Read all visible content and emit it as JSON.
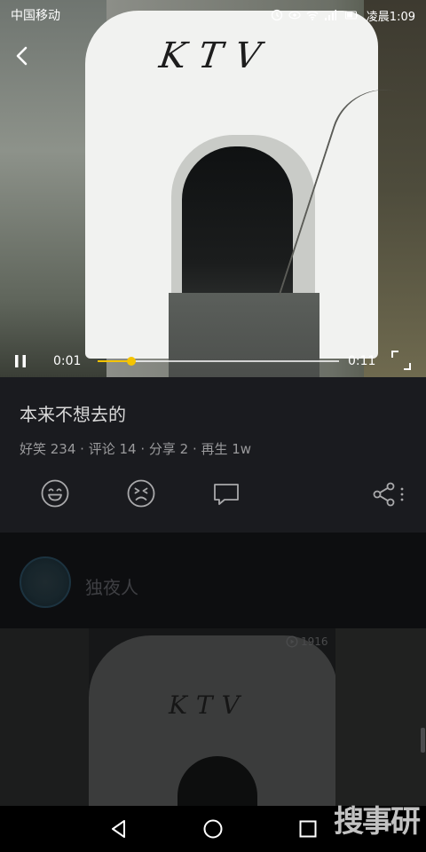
{
  "status_bar": {
    "carrier": "中国移动",
    "time": "凌晨1:09"
  },
  "video": {
    "current_time": "0:01",
    "duration": "0:11",
    "progress": 0.14,
    "scene_text": "KTV"
  },
  "post": {
    "title": "本来不想去的",
    "stats": "好笑 234 · 评论 14 · 分享 2 · 再生 1w"
  },
  "next_post": {
    "username": "独夜人",
    "play_count": "1916"
  },
  "watermark": "搜事研",
  "icons": {
    "back": "chevron-left-icon",
    "pause": "pause-icon",
    "fullscreen": "fullscreen-icon",
    "like": "smile-icon",
    "dislike": "frown-icon",
    "comment": "comment-icon",
    "share": "share-icon",
    "more": "more-dots-icon",
    "nav_back": "triangle-back-icon",
    "nav_home": "circle-home-icon",
    "nav_recent": "square-recent-icon"
  },
  "colors": {
    "accent": "#f5c400",
    "background": "#1a1b1f",
    "muted_text": "#9a9a9c"
  }
}
